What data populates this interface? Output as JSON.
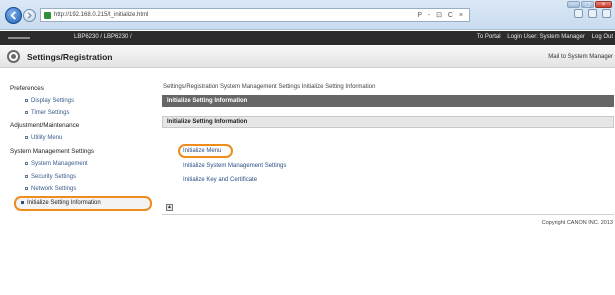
{
  "browser": {
    "url": "http://192.168.0.215/t_initialize.html",
    "address_controls": "P - ⊡ C ×",
    "window_controls": [
      "–",
      "▢",
      "×"
    ]
  },
  "header": {
    "model": "LBP6230 / LBP6230 /",
    "portal_link": "To Portal",
    "login_user": "Login User: System Manager",
    "logout_link": "Log Out"
  },
  "title_band": {
    "title": "Settings/Registration",
    "mail_link": "Mail to System Manager"
  },
  "sidebar": {
    "groups": [
      {
        "label": "Preferences",
        "items": [
          "Display Settings",
          "Timer Settings"
        ]
      },
      {
        "label": "Adjustment/Maintenance",
        "items": [
          "Utility Menu"
        ]
      },
      {
        "label": "System Management Settings",
        "items": [
          "System Management",
          "Security Settings",
          "Network Settings"
        ]
      }
    ],
    "active_item": "Initialize Setting Information"
  },
  "main": {
    "breadcrumb": "Settings/Registration  System Management Settings  Initialize Setting Information",
    "page_header": "Initialize Setting Information",
    "section_header": "Initialize Setting Information",
    "links": [
      "Initialize Menu",
      "Initialize System Management Settings",
      "Initialize Key and Certificate"
    ],
    "scroll_top_label": "▲",
    "copyright": "Copyright CANON INC. 2013"
  }
}
